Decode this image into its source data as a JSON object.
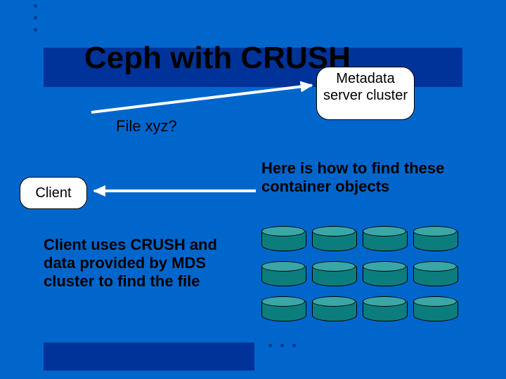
{
  "title": "Ceph with CRUSH",
  "mds_box": "Metadata server cluster",
  "query_label": "File xyz?",
  "client_label": "Client",
  "response_text": "Here is how to find these container objects",
  "explain_text": "Client uses CRUSH and data provided  by MDS cluster to find the file",
  "disk_grid": {
    "rows": 3,
    "cols": 4
  }
}
